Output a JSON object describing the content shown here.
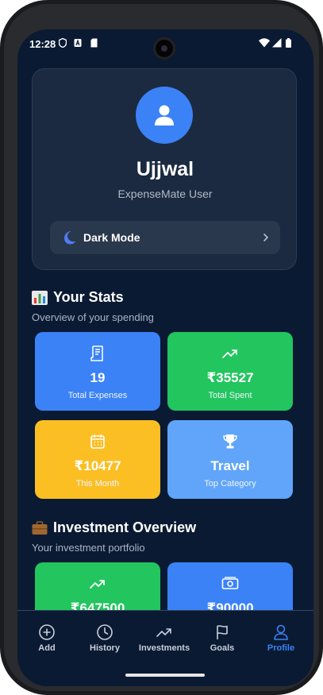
{
  "status_bar": {
    "time": "12:28"
  },
  "profile": {
    "name": "Ujjwal",
    "subtitle": "ExpenseMate User",
    "dark_mode_label": "Dark Mode"
  },
  "stats": {
    "title": "Your Stats",
    "subtitle": "Overview of your spending",
    "cards": [
      {
        "value": "19",
        "label": "Total Expenses",
        "icon": "receipt-icon",
        "color": "#3b82f6"
      },
      {
        "value": "₹35527",
        "label": "Total Spent",
        "icon": "trending-up-icon",
        "color": "#22c55e"
      },
      {
        "value": "₹10477",
        "label": "This Month",
        "icon": "calendar-icon",
        "color": "#fbbf24"
      },
      {
        "value": "Travel",
        "label": "Top Category",
        "icon": "trophy-icon",
        "color": "#60a5fa"
      }
    ]
  },
  "investments": {
    "title": "Investment Overview",
    "subtitle": "Your investment portfolio",
    "cards": [
      {
        "value": "₹647500",
        "icon": "trending-up-icon",
        "color": "#22c55e"
      },
      {
        "value": "₹90000",
        "icon": "cash-icon",
        "color": "#3b82f6"
      }
    ]
  },
  "nav": {
    "items": [
      {
        "label": "Add",
        "icon": "plus-circle-icon"
      },
      {
        "label": "History",
        "icon": "clock-icon"
      },
      {
        "label": "Investments",
        "icon": "trending-up-icon"
      },
      {
        "label": "Goals",
        "icon": "flag-icon"
      },
      {
        "label": "Profile",
        "icon": "user-icon",
        "active": true
      }
    ]
  },
  "colors": {
    "accent": "#3b82f6",
    "background": "#0b1a33",
    "card": "#1b2a40"
  }
}
